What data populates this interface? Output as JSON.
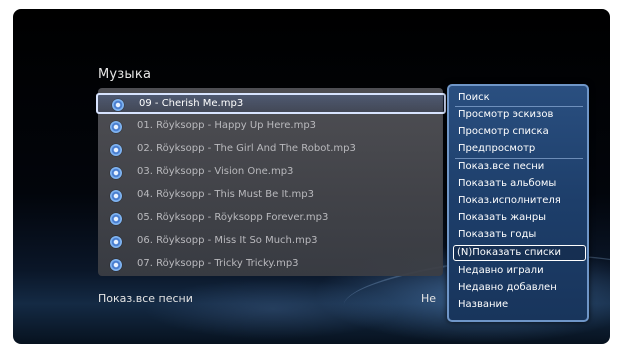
{
  "screen": {
    "section_title": "Музыка"
  },
  "tracks": [
    {
      "label": "09 - Cherish Me.mp3",
      "selected": true,
      "icon": "music-disc-icon"
    },
    {
      "label": "01. Röyksopp - Happy Up Here.mp3",
      "selected": false,
      "icon": "music-disc-icon"
    },
    {
      "label": "02. Röyksopp - The Girl And The Robot.mp3",
      "selected": false,
      "icon": "music-disc-icon"
    },
    {
      "label": "03. Röyksopp - Vision One.mp3",
      "selected": false,
      "icon": "music-disc-icon"
    },
    {
      "label": "04. Röyksopp - This Must Be It.mp3",
      "selected": false,
      "icon": "music-disc-icon"
    },
    {
      "label": "05. Röyksopp - Röyksopp Forever.mp3",
      "selected": false,
      "icon": "music-disc-icon"
    },
    {
      "label": "06. Röyksopp - Miss It So Much.mp3",
      "selected": false,
      "icon": "music-disc-icon"
    },
    {
      "label": "07. Röyksopp - Tricky Tricky.mp3",
      "selected": false,
      "icon": "music-disc-icon"
    }
  ],
  "footer": {
    "view_mode": "Показ.все песни",
    "right_partial": "Не"
  },
  "menu": {
    "items": [
      {
        "label": "Поиск"
      },
      {
        "label": "Просмотр эскизов"
      },
      {
        "label": "Просмотр списка"
      },
      {
        "label": "Предпросмотр"
      },
      {
        "label": "Показ.все песни"
      },
      {
        "label": "Показать альбомы"
      },
      {
        "label": "Показ.исполнителя"
      },
      {
        "label": "Показать жанры"
      },
      {
        "label": "Показать годы"
      },
      {
        "label": "(N)Показать списки",
        "active": true
      },
      {
        "label": "Недавно играли"
      },
      {
        "label": "Недавно добавлен"
      },
      {
        "label": "Название"
      }
    ]
  },
  "colors": {
    "menu_bg": "#1d3e6a",
    "menu_border": "#6f96c8",
    "selection_border": "#d8e4ff",
    "list_bg": "#55555a"
  }
}
